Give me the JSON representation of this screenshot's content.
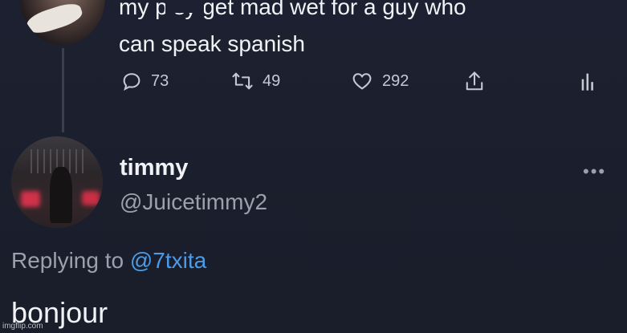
{
  "parent_tweet": {
    "text_line1": "my p    sy get mad wet for a guy who",
    "text_line2": "can speak spanish",
    "stats": {
      "replies": "73",
      "retweets": "49",
      "likes": "292"
    },
    "icons": [
      "reply-icon",
      "retweet-icon",
      "like-icon",
      "share-icon",
      "analytics-icon"
    ]
  },
  "reply_tweet": {
    "display_name": "timmy",
    "handle": "@Juicetimmy2",
    "replying_prefix": "Replying to ",
    "replying_to": "@7txita",
    "text": "bonjour"
  },
  "watermark": "imgflip.com",
  "colors": {
    "background": "#1b1f2b",
    "text": "#f1f2f5",
    "muted": "#9aa1ae",
    "link": "#4b9be8"
  }
}
